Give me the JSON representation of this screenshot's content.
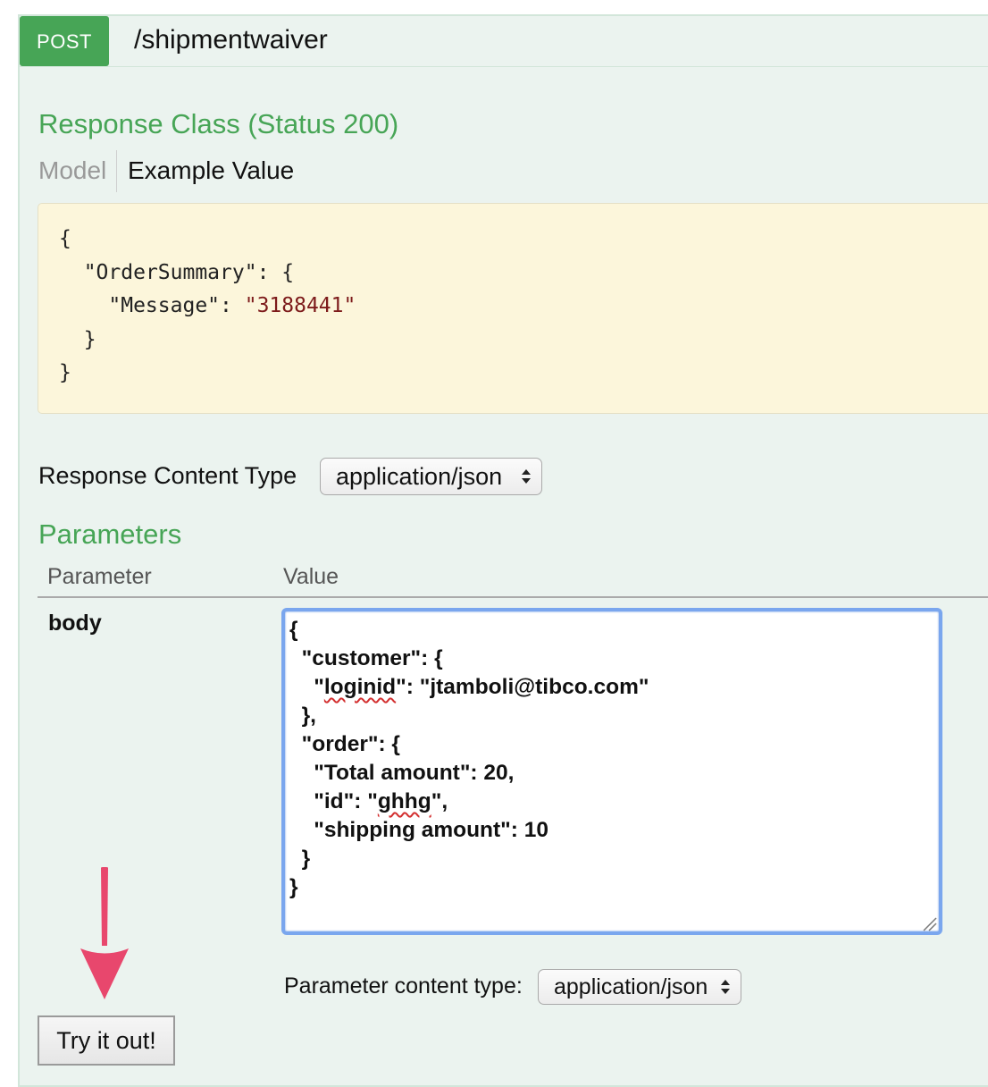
{
  "operation": {
    "method": "POST",
    "path": "/shipmentwaiver",
    "method_color": "#47a556"
  },
  "response_class": {
    "heading": "Response Class (Status 200)",
    "tabs": {
      "model": "Model",
      "example": "Example Value"
    },
    "example_lines": {
      "l1": "{",
      "l2_key": "\"OrderSummary\": {",
      "l3_key": "\"Message\": ",
      "l3_value": "\"3188441\"",
      "l4": "}",
      "l5": "}"
    }
  },
  "response_content_type": {
    "label": "Response Content Type",
    "selected": "application/json"
  },
  "parameters": {
    "heading": "Parameters",
    "columns": {
      "parameter": "Parameter",
      "value": "Value"
    },
    "rows": [
      {
        "name": "body",
        "value_lines": {
          "l1": "{",
          "l2": "  \"customer\": {",
          "l3_pre": "    \"",
          "l3_word": "loginid",
          "l3_post": "\": \"jtamboli@tibco.com\"",
          "l4": "  },",
          "l5": "  \"order\": {",
          "l6": "    \"Total amount\": 20,",
          "l7_pre": "    \"id\": \"",
          "l7_word": "ghhg",
          "l7_post": "\",",
          "l8": "    \"shipping amount\": 10",
          "l9": "  }",
          "l10": "}"
        }
      }
    ],
    "content_type_label": "Parameter content type:",
    "content_type_selected": "application/json"
  },
  "try_button_label": "Try it out!",
  "colors": {
    "panel_bg": "#ebf3ef",
    "heading_green": "#47a556",
    "example_bg": "#fcf6db",
    "focus_border": "#7aa6ee",
    "annotation_arrow": "#e8476d"
  },
  "icons": {
    "select_arrows": "up-down-chevron-icon",
    "annotation": "down-arrow-icon",
    "resize": "resize-handle-icon"
  }
}
